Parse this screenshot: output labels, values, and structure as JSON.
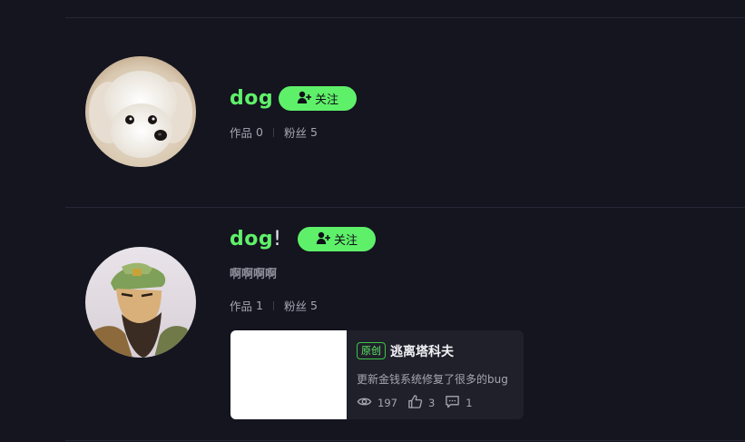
{
  "users": [
    {
      "name": "dog",
      "name_suffix": "",
      "follow_label": "关注",
      "works_label": "作品",
      "works_count": "0",
      "fans_label": "粉丝",
      "fans_count": "5",
      "bio": ""
    },
    {
      "name": "dog",
      "name_suffix": "!",
      "follow_label": "关注",
      "works_label": "作品",
      "works_count": "1",
      "fans_label": "粉丝",
      "fans_count": "5",
      "bio": "啊啊啊啊",
      "post": {
        "tag": "原创",
        "title": "逃离塔科夫",
        "description": "更新金钱系统修复了很多的bug",
        "views": "197",
        "likes": "3",
        "comments": "1"
      }
    }
  ],
  "colors": {
    "background": "#14151f",
    "accent": "#5ff06a",
    "card": "#1f2029",
    "divider": "#262836"
  },
  "icons": [
    "add-user-icon",
    "eye-icon",
    "thumbs-up-icon",
    "comment-icon"
  ]
}
